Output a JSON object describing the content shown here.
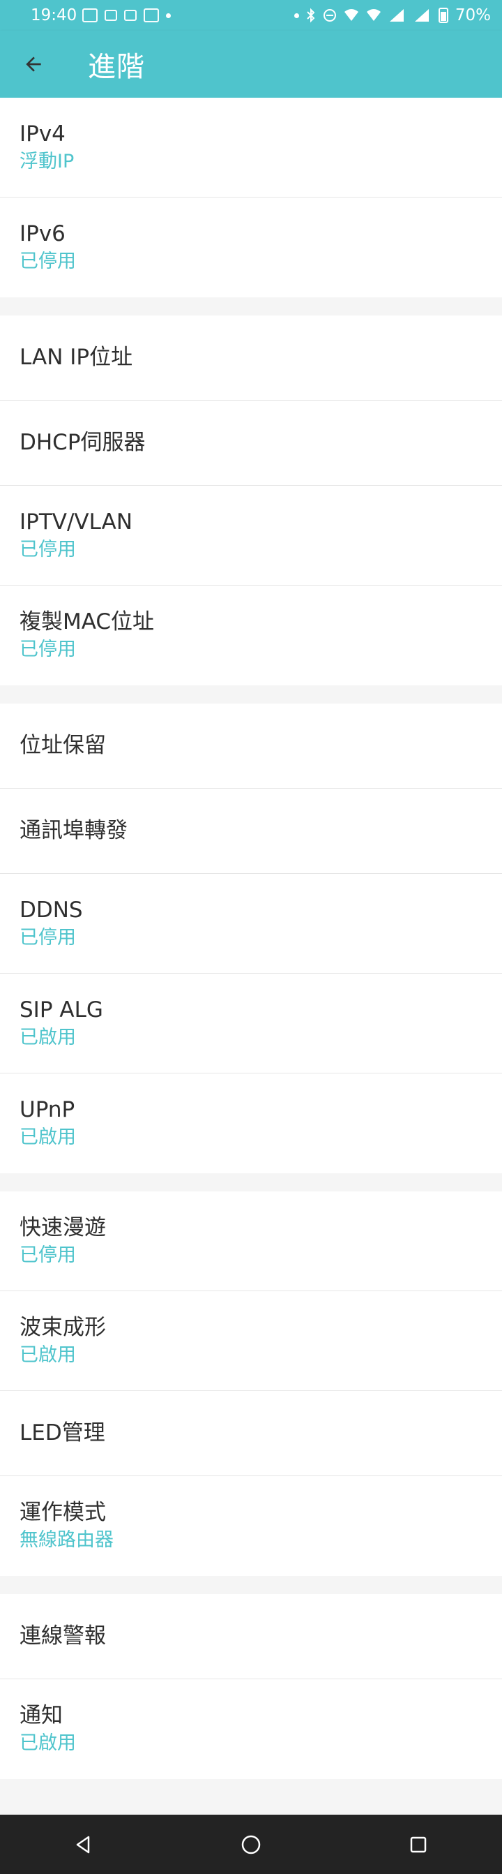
{
  "status_bar": {
    "time": "19:40",
    "battery": "70%"
  },
  "header": {
    "title": "進階"
  },
  "colors": {
    "accent": "#4fc4cc",
    "nav_bg": "#232323",
    "page_bg": "#f5f5f5"
  },
  "sections": [
    {
      "items": [
        {
          "label": "IPv4",
          "value": "浮動IP"
        },
        {
          "label": "IPv6",
          "value": "已停用"
        }
      ]
    },
    {
      "items": [
        {
          "label": "LAN IP位址",
          "value": ""
        },
        {
          "label": "DHCP伺服器",
          "value": ""
        },
        {
          "label": "IPTV/VLAN",
          "value": "已停用"
        },
        {
          "label": "複製MAC位址",
          "value": "已停用"
        }
      ]
    },
    {
      "items": [
        {
          "label": "位址保留",
          "value": ""
        },
        {
          "label": "通訊埠轉發",
          "value": ""
        },
        {
          "label": "DDNS",
          "value": "已停用"
        },
        {
          "label": "SIP ALG",
          "value": "已啟用"
        },
        {
          "label": "UPnP",
          "value": "已啟用"
        }
      ]
    },
    {
      "items": [
        {
          "label": "快速漫遊",
          "value": "已停用"
        },
        {
          "label": "波束成形",
          "value": "已啟用"
        },
        {
          "label": "LED管理",
          "value": ""
        },
        {
          "label": "運作模式",
          "value": "無線路由器"
        }
      ]
    },
    {
      "items": [
        {
          "label": "連線警報",
          "value": ""
        },
        {
          "label": "通知",
          "value": "已啟用"
        }
      ]
    }
  ],
  "icons": {
    "back": "arrow-left-icon",
    "nav_back": "triangle-back-icon",
    "nav_home": "circle-home-icon",
    "nav_recent": "square-recent-icon"
  }
}
